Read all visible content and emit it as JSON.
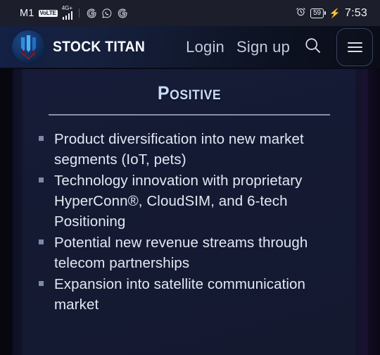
{
  "statusbar": {
    "carrier": "M1",
    "volte_badge": "VoLTE",
    "network_type": "4G+",
    "signal_icon": "signal-bars-icon",
    "app_icons": [
      "google-icon",
      "whatsapp-icon",
      "google-icon"
    ],
    "alarm_icon": "alarm-clock-icon",
    "battery_percent": "59",
    "charging_icon": "charging-bolt-icon",
    "time": "7:53"
  },
  "navbar": {
    "logo_icon": "stock-titan-logo-icon",
    "brand": "STOCK TITAN",
    "login_label": "Login",
    "signup_label": "Sign up",
    "search_icon": "search-icon",
    "menu_icon": "hamburger-menu-icon"
  },
  "content": {
    "heading": "Positive",
    "bullets": [
      "Product diversification into new market segments (IoT, pets)",
      "Technology innovation with proprietary HyperConn®, CloudSIM, and 6-tech Positioning",
      "Potential new revenue streams through telecom partnerships",
      "Expansion into satellite communication market"
    ]
  },
  "colors": {
    "page_bg": "#151a33",
    "status_bg": "#1c1f2b",
    "heading": "#c9dcf7",
    "text": "#e3e8f3",
    "bullet_marker": "#7b89ab",
    "divider": "#99a4bd"
  }
}
